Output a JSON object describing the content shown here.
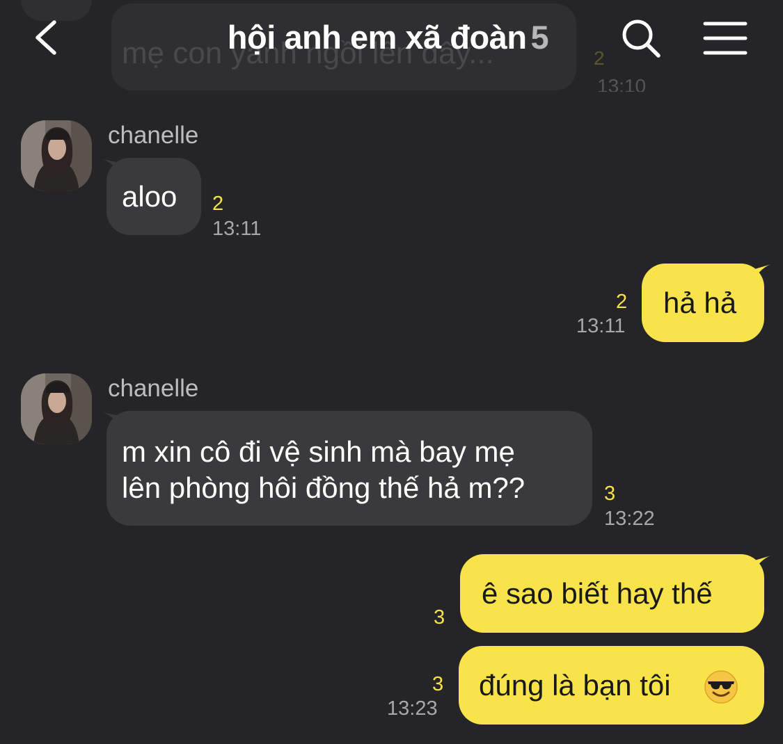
{
  "header": {
    "title": "hội anh em xã đoàn",
    "member_count": "5"
  },
  "ghost_message": {
    "text": "mẹ con yanh ngồi lên đây...",
    "unread": "2",
    "time": "13:10"
  },
  "messages": [
    {
      "direction": "incoming",
      "sender": "chanelle",
      "lines": [
        "aloo"
      ],
      "unread": "2",
      "time": "13:11"
    },
    {
      "direction": "outgoing",
      "lines": [
        "hả hả"
      ],
      "unread": "2",
      "time": "13:11"
    },
    {
      "direction": "incoming",
      "sender": "chanelle",
      "lines": [
        "m xin cô đi vệ sinh mà bay mẹ",
        "lên phòng hôi đồng thế hả m??"
      ],
      "unread": "3",
      "time": "13:22"
    },
    {
      "direction": "outgoing",
      "lines": [
        "ê sao biết hay thế"
      ],
      "unread": "3",
      "time": ""
    },
    {
      "direction": "outgoing",
      "lines": [
        "đúng là bạn tôi"
      ],
      "emoji": "😎",
      "unread": "3",
      "time": "13:23"
    }
  ],
  "icons": {
    "back": "back-arrow-icon",
    "search": "search-icon",
    "menu": "hamburger-menu-icon",
    "emoji": "sunglasses-emoji-icon"
  },
  "colors": {
    "background": "#252528",
    "incoming_bubble": "#3a3a3d",
    "outgoing_bubble": "#f9e34a",
    "unread_count": "#f7e14b",
    "timestamp": "#a8a8aa"
  }
}
